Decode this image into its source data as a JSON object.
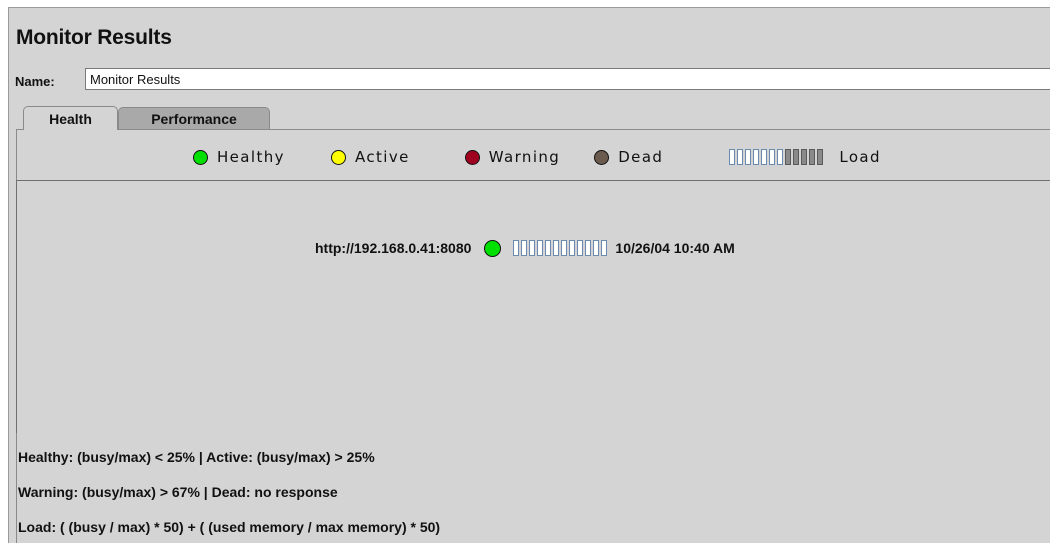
{
  "window": {
    "title": "Monitor Results"
  },
  "name_field": {
    "label": "Name:",
    "value": "Monitor Results"
  },
  "tabs": [
    {
      "label": "Health",
      "selected": true
    },
    {
      "label": "Performance",
      "selected": false
    }
  ],
  "legend": {
    "items": [
      {
        "label": "Healthy",
        "color": "#00e000",
        "icon": "green-status-dot"
      },
      {
        "label": "Active",
        "color": "#ffff00",
        "icon": "yellow-status-dot"
      },
      {
        "label": "Warning",
        "color": "#a00020",
        "icon": "red-status-dot"
      },
      {
        "label": "Dead",
        "color": "#6b5a4e",
        "icon": "brown-status-dot"
      }
    ],
    "load_label": "Load",
    "load_bar_segments": 12,
    "load_bar_filled": 5
  },
  "servers": [
    {
      "url": "http://192.168.0.41:8080",
      "status": "Healthy",
      "status_color": "#00e000",
      "load_segments": 12,
      "load_filled": 0,
      "timestamp": "10/26/04 10:40 AM"
    }
  ],
  "info": {
    "line1": "Healthy: (busy/max) < 25%  |  Active: (busy/max) > 25%",
    "line2": "Warning: (busy/max) > 67%  |  Dead: no response",
    "line3": "Load: ( (busy / max) * 50) + ( (used memory / max memory) * 50)"
  }
}
